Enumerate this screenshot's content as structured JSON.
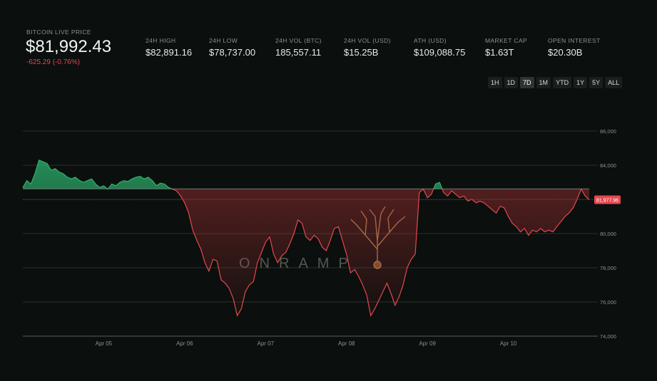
{
  "header": {
    "price_label": "BITCOIN LIVE PRICE",
    "price": "$81,992.43",
    "change": "-625.29 (-0.76%)",
    "stats": [
      {
        "label": "24H HIGH",
        "value": "$82,891.16"
      },
      {
        "label": "24H LOW",
        "value": "$78,737.00"
      },
      {
        "label": "24H VOL (BTC)",
        "value": "185,557.11"
      },
      {
        "label": "24H VOL (USD)",
        "value": "$15.25B"
      },
      {
        "label": "ATH (USD)",
        "value": "$109,088.75"
      },
      {
        "label": "MARKET CAP",
        "value": "$1.63T"
      },
      {
        "label": "OPEN INTEREST",
        "value": "$20.30B"
      }
    ]
  },
  "timeframes": {
    "items": [
      "1H",
      "1D",
      "7D",
      "1M",
      "YTD",
      "1Y",
      "5Y",
      "ALL"
    ],
    "active": "7D"
  },
  "watermark": "ONRAMP",
  "colors": {
    "up": "#2db36f",
    "down": "#e5484d",
    "background": "#0b0f0d"
  },
  "chart_data": {
    "type": "area",
    "baseline": 82617.72,
    "current_price_label": "81,977.96",
    "ylim": [
      74000,
      87000
    ],
    "yticks": [
      74000,
      76000,
      78000,
      80000,
      82000,
      84000,
      86000
    ],
    "ytick_labels": [
      "74,000",
      "76,000",
      "78,000",
      "80,000",
      "82,000",
      "84,000",
      "86,000"
    ],
    "xlim": [
      0,
      7
    ],
    "xticks": [
      1,
      2,
      3,
      4,
      5,
      6
    ],
    "xtick_labels": [
      "Apr 05",
      "Apr 06",
      "Apr 07",
      "Apr 08",
      "Apr 09",
      "Apr 10"
    ],
    "grid": true,
    "series": [
      {
        "x": [
          0,
          0.05,
          0.1,
          0.15,
          0.2,
          0.25,
          0.3,
          0.35,
          0.4,
          0.45,
          0.5,
          0.55,
          0.6,
          0.65,
          0.7,
          0.75,
          0.8,
          0.85,
          0.9,
          0.95,
          1.0,
          1.05,
          1.1,
          1.15,
          1.2,
          1.25,
          1.3,
          1.35,
          1.4,
          1.45,
          1.5,
          1.55,
          1.6,
          1.65,
          1.7,
          1.75,
          1.8,
          1.85,
          1.9,
          1.95,
          2.0,
          2.05,
          2.1,
          2.15,
          2.2,
          2.25,
          2.3,
          2.35,
          2.4,
          2.45,
          2.5,
          2.55,
          2.6,
          2.65,
          2.7,
          2.75,
          2.8,
          2.85,
          2.9,
          2.95,
          3.0,
          3.05,
          3.1,
          3.15,
          3.2,
          3.25,
          3.3,
          3.35,
          3.4,
          3.45,
          3.5,
          3.55,
          3.6,
          3.65,
          3.7,
          3.75,
          3.8,
          3.85,
          3.9,
          3.95,
          4.0,
          4.05,
          4.1,
          4.15,
          4.2,
          4.25,
          4.3,
          4.35,
          4.4,
          4.45,
          4.5,
          4.55,
          4.6,
          4.65,
          4.7,
          4.75,
          4.8,
          4.85,
          4.9,
          4.95,
          5.0,
          5.05,
          5.1,
          5.15,
          5.2,
          5.25,
          5.3,
          5.35,
          5.4,
          5.45,
          5.5,
          5.55,
          5.6,
          5.65,
          5.7,
          5.75,
          5.8,
          5.85,
          5.9,
          5.95,
          6.0,
          6.05,
          6.1,
          6.15,
          6.2,
          6.25,
          6.3,
          6.35,
          6.4,
          6.45,
          6.5,
          6.55,
          6.6,
          6.65,
          6.7,
          6.75,
          6.8,
          6.85,
          6.9,
          6.95,
          7.0
        ],
        "y": [
          82700,
          83100,
          82900,
          83500,
          84300,
          84200,
          84100,
          83700,
          83800,
          83600,
          83500,
          83300,
          83200,
          83300,
          83100,
          83000,
          83100,
          83200,
          82900,
          82700,
          82800,
          82600,
          82900,
          82800,
          83000,
          83100,
          83050,
          83200,
          83300,
          83350,
          83200,
          83300,
          83100,
          82800,
          82950,
          82900,
          82700,
          82600,
          82500,
          82200,
          81800,
          81200,
          80200,
          79600,
          79100,
          78300,
          77800,
          78500,
          78400,
          77300,
          77100,
          76800,
          76200,
          75200,
          75600,
          76600,
          77000,
          77200,
          78300,
          78900,
          79500,
          79800,
          78800,
          78300,
          78700,
          78900,
          79400,
          80000,
          80800,
          80600,
          79800,
          79600,
          79900,
          79700,
          79200,
          79000,
          79600,
          80300,
          80400,
          79600,
          78800,
          77700,
          77900,
          77500,
          77000,
          76400,
          75200,
          75600,
          76100,
          76600,
          77100,
          76500,
          75800,
          76300,
          77000,
          78000,
          78500,
          78800,
          82400,
          82600,
          82100,
          82300,
          82900,
          83000,
          82400,
          82200,
          82500,
          82300,
          82100,
          82200,
          81900,
          82000,
          81800,
          81900,
          81800,
          81600,
          81400,
          81200,
          81600,
          81500,
          81000,
          80600,
          80400,
          80100,
          80300,
          79900,
          80200,
          80100,
          80300,
          80100,
          80200,
          80100,
          80400,
          80700,
          81000,
          81200,
          81500,
          82000,
          82600,
          82200,
          81978
        ]
      }
    ]
  }
}
